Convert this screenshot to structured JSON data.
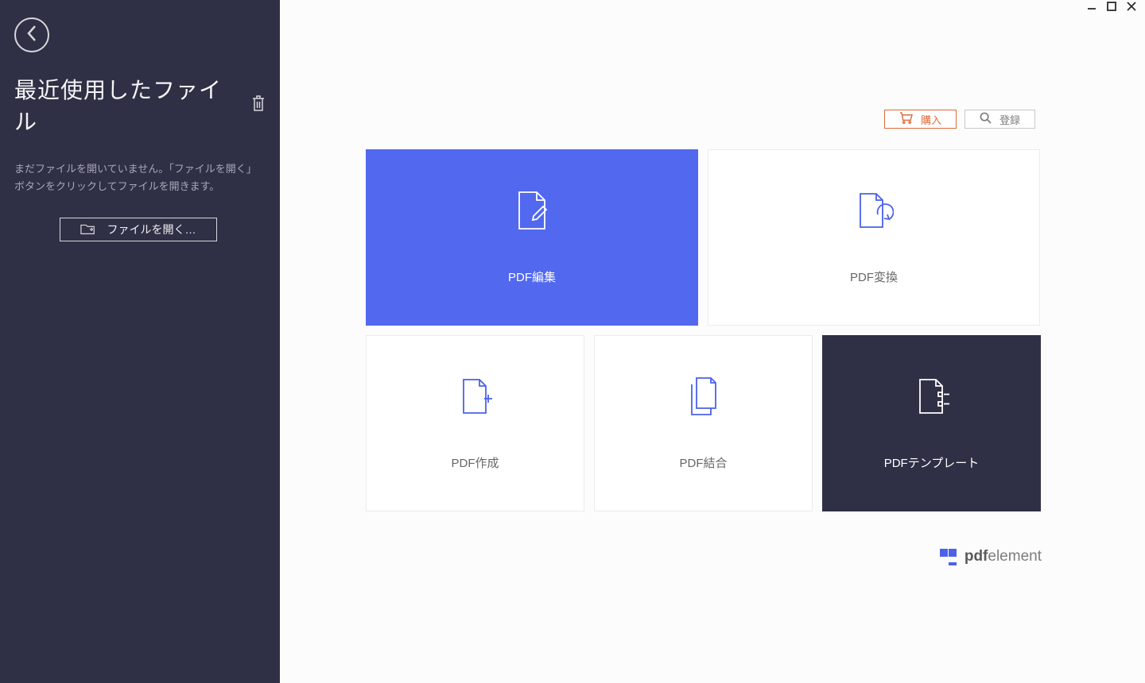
{
  "sidebar": {
    "title": "最近使用したファイル",
    "hint": "まだファイルを開いていません。「ファイルを開く」ボタンをクリックしてファイルを開きます。",
    "open_label": "ファイルを開く…"
  },
  "actions": {
    "buy_label": "購入",
    "register_label": "登録"
  },
  "tiles": {
    "edit": "PDF編集",
    "convert": "PDF変換",
    "create": "PDF作成",
    "merge": "PDF結合",
    "template": "PDFテンプレート"
  },
  "brand": {
    "bold": "pdf",
    "light": "element"
  },
  "colors": {
    "sidebar_bg": "#2f3045",
    "accent_blue": "#5168ef",
    "accent_orange": "#e06b3c",
    "dark_tile": "#2f3045"
  }
}
